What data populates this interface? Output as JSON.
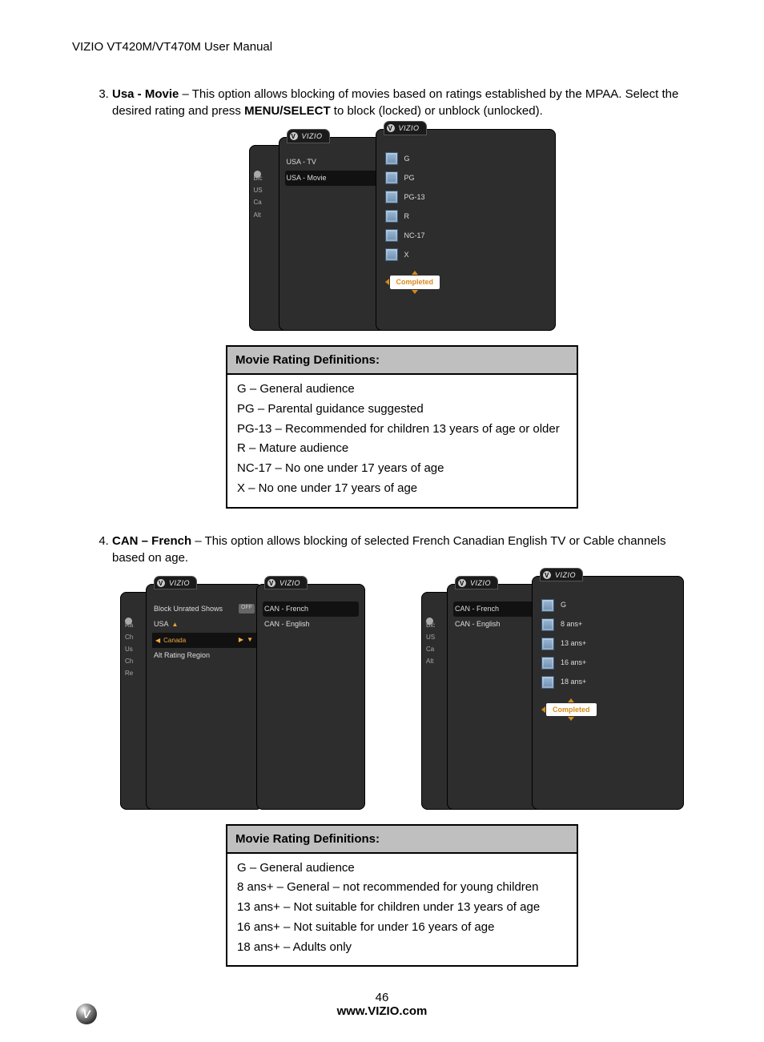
{
  "header": "VIZIO VT420M/VT470M User Manual",
  "list_start": 3,
  "items": [
    {
      "title": "Usa - Movie",
      "desc_before": " – This option allows blocking of movies based on ratings established by the MPAA. Select the desired rating and press ",
      "menu_select": "MENU/SELECT",
      "desc_after": " to block (locked) or unblock (unlocked).",
      "osd": {
        "brand": "VIZIO",
        "back_stubs": [
          "Blc",
          "US",
          "Ca",
          "Alt"
        ],
        "mid_rows": [
          {
            "label": "USA - TV"
          },
          {
            "label": "USA - Movie",
            "active": true
          }
        ],
        "options": [
          "G",
          "PG",
          "PG-13",
          "R",
          "NC-17",
          "X"
        ],
        "completed": "Completed"
      },
      "def_title": "Movie Rating Definitions:",
      "defs": [
        "G     – General audience",
        "PG   – Parental guidance suggested",
        "PG-13   –  Recommended  for  children  13  years  of  age  or older",
        "R     – Mature audience",
        "NC-17     – No one under 17 years of age",
        "X     – No one under 17 years of age"
      ]
    },
    {
      "title": "CAN – French",
      "desc_before": " – This option allows blocking of selected French Canadian English TV or Cable channels based on age.",
      "osd_left": {
        "brand": "VIZIO",
        "back_logo": "V",
        "back_rows": [
          "Ra",
          "Ch",
          "Us",
          "Ch",
          "Re"
        ],
        "mid": {
          "block_unrated": "Block Unrated Shows",
          "off": "OFF",
          "usa": "USA",
          "canada": "Canada",
          "alt": "Alt Rating Region"
        },
        "right_rows": [
          {
            "label": "CAN - French",
            "active": true
          },
          {
            "label": "CAN - English"
          }
        ]
      },
      "osd_right": {
        "brand": "VIZIO",
        "back_stubs": [
          "Blc",
          "US",
          "Ca",
          "Alt"
        ],
        "mid_rows": [
          {
            "label": "CAN - French",
            "active": true
          },
          {
            "label": "CAN - English"
          }
        ],
        "options": [
          "G",
          "8 ans+",
          "13 ans+",
          "16 ans+",
          "18 ans+"
        ],
        "completed": "Completed"
      },
      "def_title": "Movie Rating Definitions:",
      "defs": [
        "G     – General audience",
        "8 ans+     – General – not recommended for young children",
        "13 ans+   – Not suitable for children under 13 years of age",
        "16 ans+   – Not suitable for  under 16 years of age",
        "18 ans+   – Adults only"
      ]
    }
  ],
  "page_number": "46",
  "footer_url": "www.VIZIO.com",
  "footer_logo": "V"
}
